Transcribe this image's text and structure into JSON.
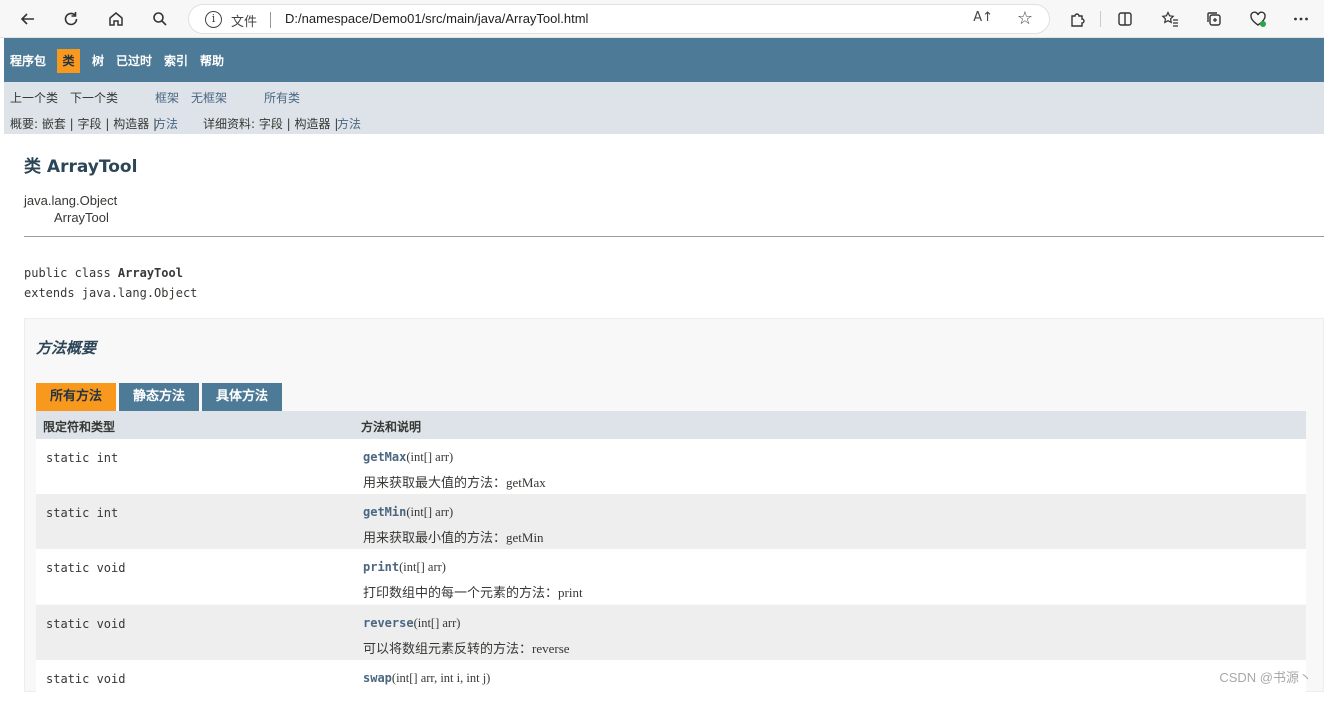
{
  "browser": {
    "file_label": "文件",
    "url": "D:/namespace/Demo01/src/main/java/ArrayTool.html",
    "read_aloud_label": "A↑"
  },
  "nav": {
    "items": [
      "程序包",
      "类",
      "树",
      "已过时",
      "索引",
      "帮助"
    ],
    "active": "类"
  },
  "subnav": {
    "prev_class": "上一个类",
    "next_class": "下一个类",
    "frames": "框架",
    "no_frames": "无框架",
    "all_classes": "所有类",
    "summary_label": "概要: 嵌套 | 字段 | 构造器 |",
    "summary_method": "方法",
    "detail_label": "详细资料: 字段 | 构造器 |",
    "detail_method": "方法"
  },
  "page": {
    "title": "类 ArrayTool",
    "inherit_parent": "java.lang.Object",
    "inherit_child": "ArrayTool",
    "decl_prefix": "public class ",
    "decl_class": "ArrayTool",
    "decl_extends": "extends java.lang.Object"
  },
  "method_summary": {
    "heading": "方法概要",
    "tabs": [
      "所有方法",
      "静态方法",
      "具体方法"
    ],
    "active_tab": "所有方法",
    "columns": [
      "限定符和类型",
      "方法和说明"
    ],
    "rows": [
      {
        "modifier": "static int",
        "name": "getMax",
        "params": "(int[]  arr)",
        "description": "用来获取最大值的方法：getMax"
      },
      {
        "modifier": "static int",
        "name": "getMin",
        "params": "(int[]  arr)",
        "description": "用来获取最小值的方法：getMin"
      },
      {
        "modifier": "static void",
        "name": "print",
        "params": "(int[]  arr)",
        "description": "打印数组中的每一个元素的方法：print"
      },
      {
        "modifier": "static void",
        "name": "reverse",
        "params": "(int[]  arr)",
        "description": "可以将数组元素反转的方法：reverse"
      },
      {
        "modifier": "static void",
        "name": "swap",
        "params": "(int[]  arr, int  i, int  j)",
        "description": ""
      }
    ]
  },
  "watermark": "CSDN @书源丶",
  "colors": {
    "nav_bg": "#4d7a97",
    "active_tab": "#f8981d",
    "subnav_bg": "#dee3e9",
    "link": "#4a6782"
  }
}
